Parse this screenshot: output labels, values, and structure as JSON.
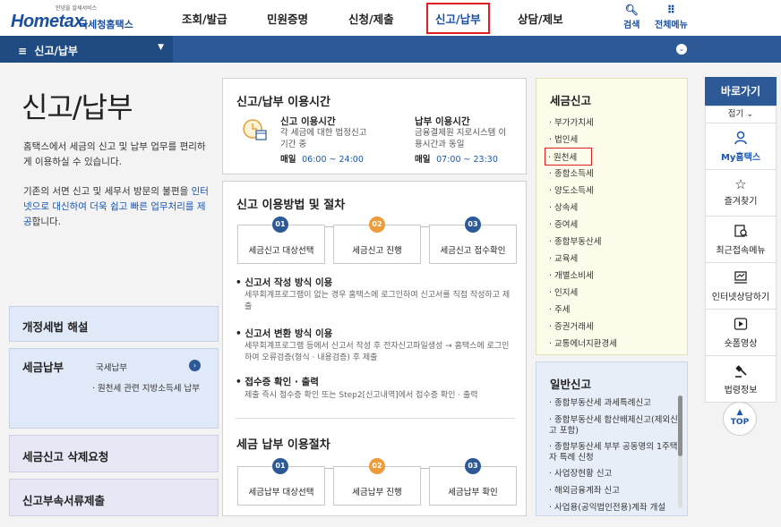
{
  "header": {
    "slogan": "안녕을 알세서비스",
    "logo_home": "Home",
    "logo_tax": "tax.",
    "logo_name": "국세청홈택스",
    "menu": [
      "조회/발급",
      "민원증명",
      "신청/제출",
      "신고/납부",
      "상담/제보"
    ],
    "active_menu": "신고/납부",
    "search_label": "검색",
    "allmenu_label": "전체메뉴"
  },
  "navbar": {
    "breadcrumb": "신고/납부"
  },
  "left": {
    "title": "신고/납부",
    "intro1": "홈택스에서 세금의 신고 및 납부 업무를 편리하게 이용하실 수 있습니다.",
    "intro2_pre": "기존의 서면 신고 및 세무서 방문의 불편을 ",
    "intro2_hl": "인터넷으로 대신하여 더욱 쉽고 빠른 업무처리를 제공",
    "intro2_post": "합니다.",
    "box1": "개정세법 해설",
    "box2": "세금납부",
    "box2_sub1": "국세납부",
    "box2_sub2": "· 원천세 관련 지방소득세 납부",
    "box3": "세금신고 삭제요청",
    "box4": "신고부속서류제출"
  },
  "hours": {
    "title": "신고/납부 이용시간",
    "report_title": "신고 이용시간",
    "report_desc": "각 세금에 대한 법정신고 기간 중",
    "report_daily": "매일",
    "report_time": "06:00 ~ 24:00",
    "pay_title": "납부 이용시간",
    "pay_desc": "금융결제원 지로시스템 이용시간과 동일",
    "pay_daily": "매일",
    "pay_time": "07:00 ~ 23:30"
  },
  "method": {
    "title": "신고 이용방법 및 절차",
    "steps": [
      {
        "num": "01",
        "label": "세금신고 대상선택"
      },
      {
        "num": "02",
        "label": "세금신고 진행"
      },
      {
        "num": "03",
        "label": "세금신고 접수확인"
      }
    ],
    "m1_title": "• 신고서 작성 방식 이용",
    "m1_txt": "세무회계프로그램이 없는 경우 홈택스에 로그인하여 신고서를 직접 작성하고 제출",
    "m2_title": "• 신고서 변환 방식 이용",
    "m2_txt": "세무회계프로그램 등에서 신고서 작성 후 전자신고파일생성 → 홈택스에 로그인하여 오류검증(형식 · 내용검증) 후 제출",
    "m3_title": "• 접수증 확인 · 출력",
    "m3_txt": "제출 즉시 접수증 확인 또는 Step2[신고내역]에서 접수증 확인 · 출력"
  },
  "pay": {
    "title": "세금 납부 이용절차",
    "steps": [
      {
        "num": "01",
        "label": "세금납부 대상선택"
      },
      {
        "num": "02",
        "label": "세금납부 진행"
      },
      {
        "num": "03",
        "label": "세금납부 확인"
      }
    ]
  },
  "taxreport": {
    "title": "세금신고",
    "items": [
      "· 부가가치세",
      "· 법인세",
      "· 원천세",
      "· 종합소득세",
      "· 양도소득세",
      "· 상속세",
      "· 증여세",
      "· 종합부동산세",
      "· 교육세",
      "· 개별소비세",
      "· 인지세",
      "· 주세",
      "· 증권거래세",
      "· 교통에너지환경세"
    ]
  },
  "general": {
    "title": "일반신고",
    "items": [
      "· 종합부동산세 과세특례신고",
      "· 종합부동산세 합산배제신고(제외신고 포함)",
      "· 종합부동산세 부부 공동명의 1주택자 특례 신청",
      "· 사업장현황 신고",
      "· 해외금융계좌 신고",
      "· 사업용(공익법인전용)계좌 개설"
    ]
  },
  "quick": {
    "title": "바로가기",
    "fold": "접기 ⌄",
    "items": [
      {
        "icon": "person-icon",
        "label": "My홈택스"
      },
      {
        "icon": "star-icon",
        "label": "즐겨찾기"
      },
      {
        "icon": "recent-icon",
        "label": "최근접속메뉴"
      },
      {
        "icon": "chat-icon",
        "label": "인터넷상담하기"
      },
      {
        "icon": "play-icon",
        "label": "숏폼영상"
      },
      {
        "icon": "gavel-icon",
        "label": "법령정보"
      }
    ],
    "top_label": "TOP"
  }
}
